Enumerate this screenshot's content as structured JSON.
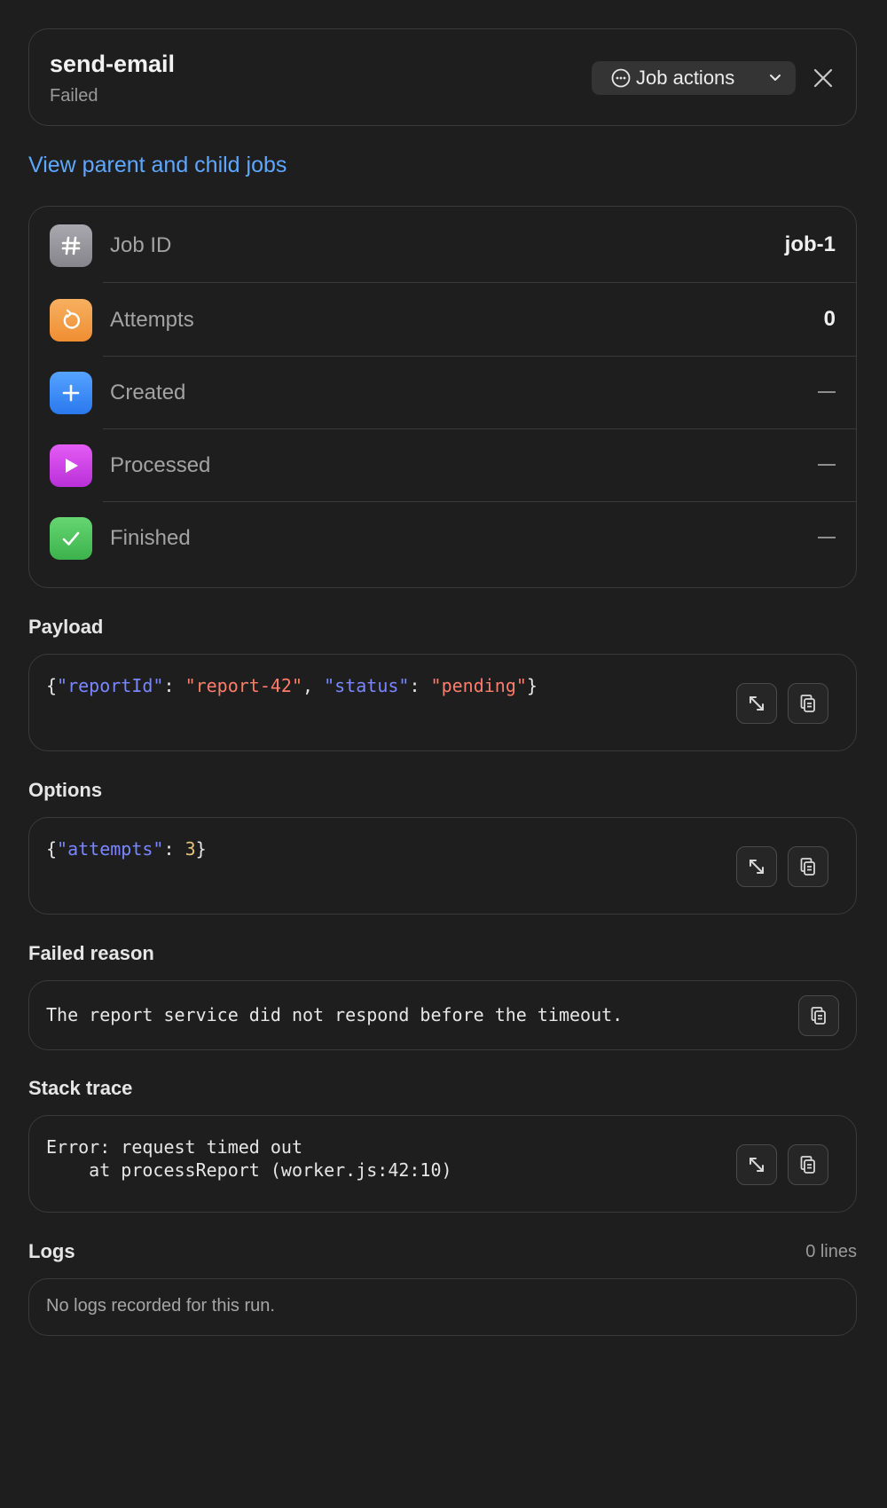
{
  "header": {
    "job_name": "send-email",
    "status": "Failed",
    "actions_label": "Job actions"
  },
  "link_label": "View parent and child jobs",
  "info_rows": [
    {
      "label": "Job ID",
      "value": "job-1",
      "icon": "hash-icon",
      "color": "#9a9aa0"
    },
    {
      "label": "Attempts",
      "value": "0",
      "icon": "retry-icon",
      "color": "#f5a14a"
    },
    {
      "label": "Created",
      "value": "—",
      "icon": "plus-icon",
      "color": "#3b8cf7"
    },
    {
      "label": "Processed",
      "value": "—",
      "icon": "play-icon",
      "color": "#d044e8"
    },
    {
      "label": "Finished",
      "value": "—",
      "icon": "check-icon",
      "color": "#4cc95a"
    }
  ],
  "sections": {
    "payload": {
      "title": "Payload",
      "tokens": [
        "{",
        "\"reportId\"",
        ": ",
        "\"report-42\"",
        ", ",
        "\"status\"",
        ": ",
        "\"pending\"",
        "}"
      ]
    },
    "options": {
      "title": "Options",
      "tokens": [
        "{",
        "\"attempts\"",
        ": ",
        "3",
        "}"
      ]
    },
    "failed_reason": {
      "title": "Failed reason",
      "text": "The report service did not respond before the timeout."
    },
    "stack_trace": {
      "title": "Stack trace",
      "line1": "Error: request timed out",
      "line2": "    at processReport (worker.js:42:10)"
    },
    "logs": {
      "title": "Logs",
      "count": "0 lines",
      "empty_text": "No logs recorded for this run."
    }
  },
  "colors": {
    "background": "#1e1e1e",
    "link": "#5ea7ff",
    "json_key": "#7a86ff",
    "json_string": "#ff7b6b",
    "json_number": "#e4c27a"
  }
}
